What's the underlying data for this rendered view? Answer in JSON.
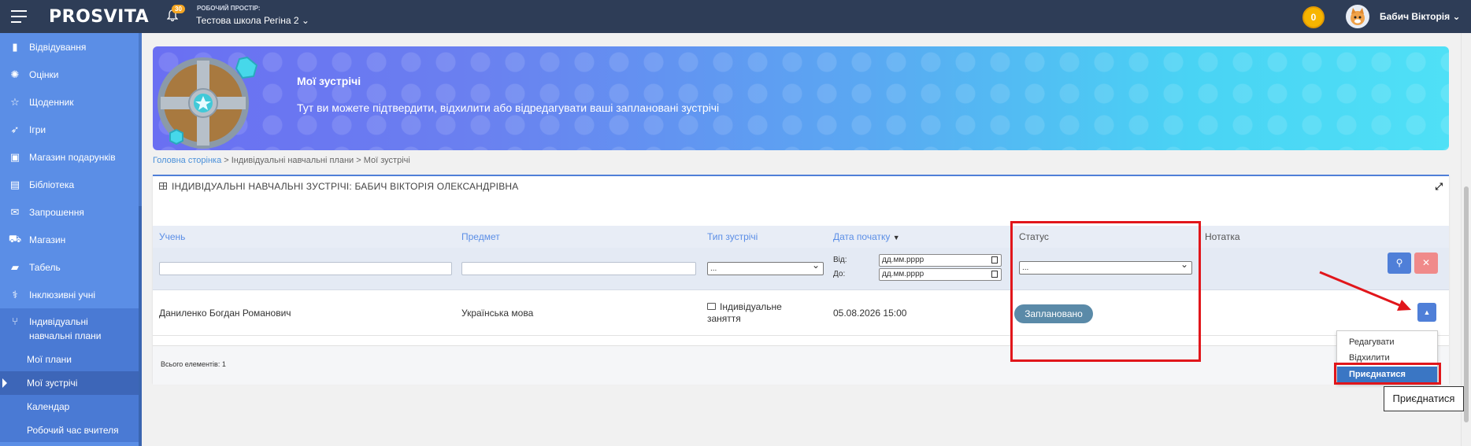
{
  "topbar": {
    "logo": "PROSVITA",
    "notifications_count": "30",
    "workspace_label": "РОБОЧИЙ ПРОСТІР:",
    "workspace_name": "Тестова школа Регіна 2",
    "coins": "0",
    "user_name": "Бабич Вікторія"
  },
  "sidebar": {
    "items": [
      {
        "label": "Відвідування",
        "icon": "file-icon"
      },
      {
        "label": "Оцінки",
        "icon": "sun-icon"
      },
      {
        "label": "Щоденник",
        "icon": "star-icon"
      },
      {
        "label": "Ігри",
        "icon": "rocket-icon"
      },
      {
        "label": "Магазин подарунків",
        "icon": "gift-icon"
      },
      {
        "label": "Бібліотека",
        "icon": "book-icon"
      },
      {
        "label": "Запрошення",
        "icon": "envelope-icon"
      },
      {
        "label": "Магазин",
        "icon": "cart-icon"
      },
      {
        "label": "Табель",
        "icon": "folder-icon"
      },
      {
        "label": "Інклюзивні учні",
        "icon": "stethoscope-icon"
      }
    ],
    "active_group": {
      "label_line1": "Індивідуальні",
      "label_line2": "навчальні плани",
      "icon": "branch-icon"
    },
    "subitems": [
      {
        "label": "Мої плани"
      },
      {
        "label": "Мої зустрічі"
      },
      {
        "label": "Календар"
      },
      {
        "label": "Робочий час вчителя"
      }
    ]
  },
  "banner": {
    "title": "Мої зустрічі",
    "subtitle": "Тут ви можете підтвердити, відхилити або відредагувати ваші заплановані зустрічі"
  },
  "breadcrumb": {
    "home": "Головна сторінка",
    "rest": " > Індивідуальні навчальні плани > Мої зустрічі"
  },
  "panel": {
    "title": "ІНДИВІДУАЛЬНІ НАВЧАЛЬНІ ЗУСТРІЧІ: БАБИЧ ВІКТОРІЯ ОЛЕКСАНДРІВНА",
    "columns": {
      "student": "Учень",
      "subject": "Предмет",
      "meeting_type": "Тип зустрічі",
      "start_date": "Дата початку",
      "status": "Статус",
      "note": "Нотатка"
    },
    "filters": {
      "type_select": "...",
      "status_select": "...",
      "from_label": "Від:",
      "to_label": "До:",
      "from_value": "дд.мм.рррр",
      "to_value": "дд.мм.рррр"
    },
    "rows": [
      {
        "student": "Даниленко Богдан Романович",
        "subject": "Українська мова",
        "type_line1": "Індивідуальне",
        "type_line2": "заняття",
        "date": "05.08.2026 15:00",
        "status": "Заплановано"
      }
    ],
    "total": "Всього елементів: 1"
  },
  "dropdown": {
    "items": [
      "Редагувати",
      "Відхилити",
      "Приєднатися"
    ]
  },
  "tooltip": "Приєднатися",
  "colors": {
    "topbar": "#2e3d57",
    "sidebar": "#5b8ee6",
    "accent": "#4f7fd8",
    "status_badge": "#5a8aa8",
    "highlight": "#e1161b"
  }
}
